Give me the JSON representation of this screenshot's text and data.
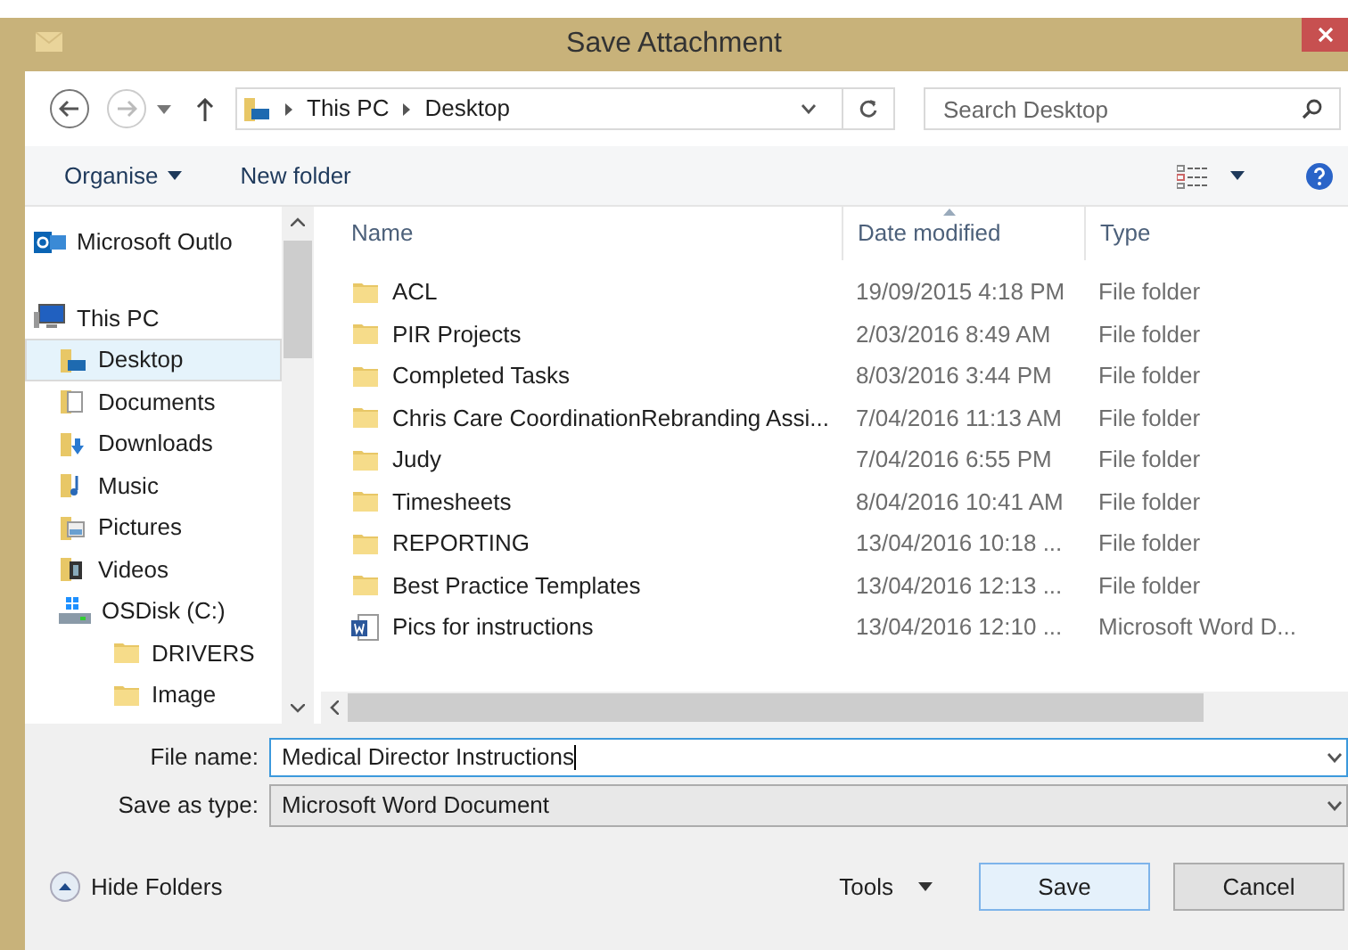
{
  "window": {
    "title": "Save Attachment"
  },
  "address": {
    "path": [
      "This PC",
      "Desktop"
    ]
  },
  "search": {
    "placeholder": "Search Desktop"
  },
  "toolbar": {
    "organise": "Organise",
    "new_folder": "New folder"
  },
  "nav": [
    {
      "label": "Microsoft Outlo",
      "kind": "outlook",
      "selected": false
    },
    {
      "label": "This PC",
      "kind": "pc",
      "selected": false,
      "children": [
        {
          "label": "Desktop",
          "kind": "desktop",
          "selected": true
        },
        {
          "label": "Documents",
          "kind": "documents",
          "selected": false
        },
        {
          "label": "Downloads",
          "kind": "downloads",
          "selected": false
        },
        {
          "label": "Music",
          "kind": "music",
          "selected": false
        },
        {
          "label": "Pictures",
          "kind": "pictures",
          "selected": false
        },
        {
          "label": "Videos",
          "kind": "videos",
          "selected": false
        },
        {
          "label": "OSDisk (C:)",
          "kind": "drive",
          "selected": false,
          "children": [
            {
              "label": "DRIVERS",
              "kind": "folder",
              "selected": false
            },
            {
              "label": "Image",
              "kind": "folder",
              "selected": false
            }
          ]
        }
      ]
    }
  ],
  "table": {
    "columns": [
      "Name",
      "Date modified",
      "Type"
    ],
    "rows": [
      {
        "name": "ACL",
        "date": "19/09/2015 4:18 PM",
        "type": "File folder",
        "kind": "folder"
      },
      {
        "name": "PIR Projects",
        "date": "2/03/2016 8:49 AM",
        "type": "File folder",
        "kind": "folder"
      },
      {
        "name": "Completed Tasks",
        "date": "8/03/2016 3:44 PM",
        "type": "File folder",
        "kind": "folder"
      },
      {
        "name": "Chris Care CoordinationRebranding Assi...",
        "date": "7/04/2016 11:13 AM",
        "type": "File folder",
        "kind": "folder"
      },
      {
        "name": "Judy",
        "date": "7/04/2016 6:55 PM",
        "type": "File folder",
        "kind": "folder"
      },
      {
        "name": "Timesheets",
        "date": "8/04/2016 10:41 AM",
        "type": "File folder",
        "kind": "folder"
      },
      {
        "name": "REPORTING",
        "date": "13/04/2016 10:18 ...",
        "type": "File folder",
        "kind": "folder"
      },
      {
        "name": "Best Practice Templates",
        "date": "13/04/2016 12:13 ...",
        "type": "File folder",
        "kind": "folder"
      },
      {
        "name": "Pics for instructions",
        "date": "13/04/2016 12:10 ...",
        "type": "Microsoft Word D...",
        "kind": "word"
      }
    ]
  },
  "file_name": {
    "label": "File name:",
    "value": "Medical Director Instructions"
  },
  "save_type": {
    "label": "Save as type:",
    "value": "Microsoft Word Document"
  },
  "hide_folders": "Hide Folders",
  "tools": "Tools",
  "buttons": [
    "Save",
    "Cancel"
  ]
}
